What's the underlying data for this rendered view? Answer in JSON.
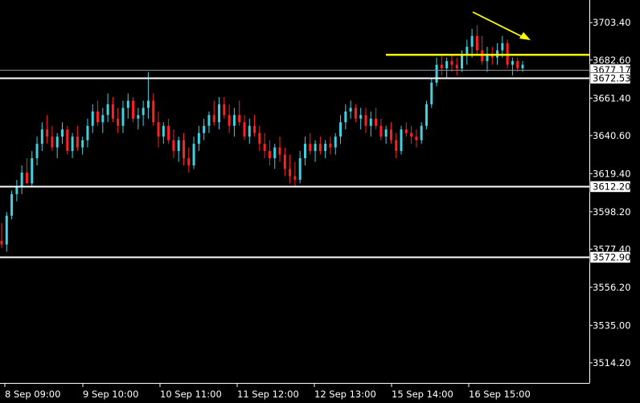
{
  "colors": {
    "background": "#000000",
    "axis": "#ffffff",
    "bull": "#40d0e0",
    "bear": "#ff2020",
    "level_line": "#ffffff",
    "resistance_line": "#ffff00",
    "arrow": "#ffff00",
    "bid_line": "#8a8f9a"
  },
  "chart_data": {
    "type": "candlestick",
    "title": "",
    "xlabel": "",
    "ylabel": "",
    "ylim": [
      3503,
      3716
    ],
    "grid": false,
    "y_ticks": [
      "3703.40",
      "3682.60",
      "3661.40",
      "3640.60",
      "3619.40",
      "3598.20",
      "3577.40",
      "3556.20",
      "3535.00",
      "3514.20"
    ],
    "x_ticks": [
      "8 Sep 09:00",
      "9 Sep 10:00",
      "10 Sep 11:00",
      "11 Sep 12:00",
      "12 Sep 13:00",
      "15 Sep 14:00",
      "16 Sep 15:00"
    ],
    "current_price": "3677.17",
    "levels": [
      {
        "label": "3672.53",
        "value": 3672.53
      },
      {
        "label": "3612.20",
        "value": 3612.2
      },
      {
        "label": "3572.90",
        "value": 3572.9
      }
    ],
    "resistance": 3685.5,
    "candles": [
      [
        3582,
        3592,
        3578,
        3580
      ],
      [
        3580,
        3598,
        3576,
        3596
      ],
      [
        3596,
        3610,
        3594,
        3608
      ],
      [
        3608,
        3616,
        3604,
        3612
      ],
      [
        3612,
        3624,
        3608,
        3620
      ],
      [
        3620,
        3628,
        3616,
        3614
      ],
      [
        3614,
        3632,
        3612,
        3628
      ],
      [
        3628,
        3640,
        3624,
        3636
      ],
      [
        3636,
        3648,
        3632,
        3644
      ],
      [
        3644,
        3652,
        3636,
        3640
      ],
      [
        3640,
        3646,
        3632,
        3634
      ],
      [
        3634,
        3642,
        3628,
        3640
      ],
      [
        3640,
        3648,
        3636,
        3644
      ],
      [
        3644,
        3646,
        3630,
        3632
      ],
      [
        3632,
        3642,
        3628,
        3640
      ],
      [
        3640,
        3646,
        3632,
        3634
      ],
      [
        3634,
        3640,
        3630,
        3638
      ],
      [
        3638,
        3650,
        3634,
        3646
      ],
      [
        3646,
        3658,
        3642,
        3654
      ],
      [
        3654,
        3660,
        3646,
        3648
      ],
      [
        3648,
        3656,
        3642,
        3652
      ],
      [
        3652,
        3664,
        3648,
        3658
      ],
      [
        3658,
        3662,
        3648,
        3650
      ],
      [
        3650,
        3656,
        3642,
        3646
      ],
      [
        3646,
        3660,
        3642,
        3656
      ],
      [
        3656,
        3664,
        3650,
        3660
      ],
      [
        3660,
        3662,
        3648,
        3650
      ],
      [
        3650,
        3656,
        3644,
        3652
      ],
      [
        3652,
        3660,
        3646,
        3656
      ],
      [
        3656,
        3676,
        3650,
        3660
      ],
      [
        3660,
        3664,
        3646,
        3648
      ],
      [
        3648,
        3654,
        3634,
        3640
      ],
      [
        3640,
        3648,
        3636,
        3646
      ],
      [
        3646,
        3650,
        3636,
        3638
      ],
      [
        3638,
        3644,
        3628,
        3632
      ],
      [
        3632,
        3640,
        3626,
        3638
      ],
      [
        3638,
        3642,
        3624,
        3628
      ],
      [
        3628,
        3634,
        3620,
        3624
      ],
      [
        3624,
        3640,
        3622,
        3636
      ],
      [
        3636,
        3646,
        3632,
        3642
      ],
      [
        3642,
        3650,
        3638,
        3646
      ],
      [
        3646,
        3654,
        3642,
        3652
      ],
      [
        3652,
        3660,
        3646,
        3648
      ],
      [
        3648,
        3662,
        3644,
        3658
      ],
      [
        3658,
        3662,
        3650,
        3652
      ],
      [
        3652,
        3658,
        3642,
        3646
      ],
      [
        3646,
        3656,
        3640,
        3652
      ],
      [
        3652,
        3660,
        3646,
        3648
      ],
      [
        3648,
        3652,
        3638,
        3640
      ],
      [
        3640,
        3650,
        3636,
        3646
      ],
      [
        3646,
        3652,
        3640,
        3642
      ],
      [
        3642,
        3646,
        3632,
        3636
      ],
      [
        3636,
        3642,
        3628,
        3632
      ],
      [
        3632,
        3638,
        3624,
        3628
      ],
      [
        3628,
        3636,
        3622,
        3634
      ],
      [
        3634,
        3640,
        3626,
        3630
      ],
      [
        3630,
        3634,
        3618,
        3622
      ],
      [
        3622,
        3630,
        3614,
        3618
      ],
      [
        3618,
        3626,
        3612,
        3616
      ],
      [
        3616,
        3632,
        3614,
        3628
      ],
      [
        3628,
        3640,
        3624,
        3636
      ],
      [
        3636,
        3642,
        3630,
        3632
      ],
      [
        3632,
        3638,
        3626,
        3636
      ],
      [
        3636,
        3640,
        3630,
        3632
      ],
      [
        3632,
        3638,
        3628,
        3636
      ],
      [
        3636,
        3640,
        3630,
        3634
      ],
      [
        3634,
        3642,
        3630,
        3640
      ],
      [
        3640,
        3652,
        3636,
        3648
      ],
      [
        3648,
        3658,
        3644,
        3654
      ],
      [
        3654,
        3660,
        3650,
        3656
      ],
      [
        3656,
        3658,
        3648,
        3650
      ],
      [
        3650,
        3656,
        3644,
        3652
      ],
      [
        3652,
        3656,
        3642,
        3646
      ],
      [
        3646,
        3654,
        3640,
        3650
      ],
      [
        3650,
        3656,
        3644,
        3646
      ],
      [
        3646,
        3650,
        3638,
        3640
      ],
      [
        3640,
        3646,
        3636,
        3644
      ],
      [
        3644,
        3648,
        3636,
        3638
      ],
      [
        3638,
        3642,
        3628,
        3632
      ],
      [
        3632,
        3646,
        3630,
        3644
      ],
      [
        3644,
        3648,
        3640,
        3642
      ],
      [
        3642,
        3646,
        3636,
        3640
      ],
      [
        3640,
        3644,
        3634,
        3638
      ],
      [
        3638,
        3648,
        3636,
        3646
      ],
      [
        3646,
        3660,
        3644,
        3658
      ],
      [
        3658,
        3672,
        3656,
        3670
      ],
      [
        3670,
        3684,
        3668,
        3680
      ],
      [
        3680,
        3686,
        3674,
        3678
      ],
      [
        3678,
        3684,
        3672,
        3682
      ],
      [
        3682,
        3686,
        3676,
        3680
      ],
      [
        3680,
        3684,
        3674,
        3678
      ],
      [
        3678,
        3688,
        3676,
        3686
      ],
      [
        3686,
        3694,
        3680,
        3690
      ],
      [
        3690,
        3700,
        3684,
        3696
      ],
      [
        3696,
        3702,
        3686,
        3688
      ],
      [
        3688,
        3696,
        3680,
        3682
      ],
      [
        3682,
        3690,
        3676,
        3686
      ],
      [
        3686,
        3690,
        3680,
        3684
      ],
      [
        3684,
        3692,
        3680,
        3688
      ],
      [
        3688,
        3696,
        3684,
        3692
      ],
      [
        3692,
        3694,
        3678,
        3680
      ],
      [
        3680,
        3684,
        3674,
        3682
      ],
      [
        3682,
        3684,
        3676,
        3678
      ],
      [
        3678,
        3682,
        3676,
        3680
      ]
    ]
  }
}
